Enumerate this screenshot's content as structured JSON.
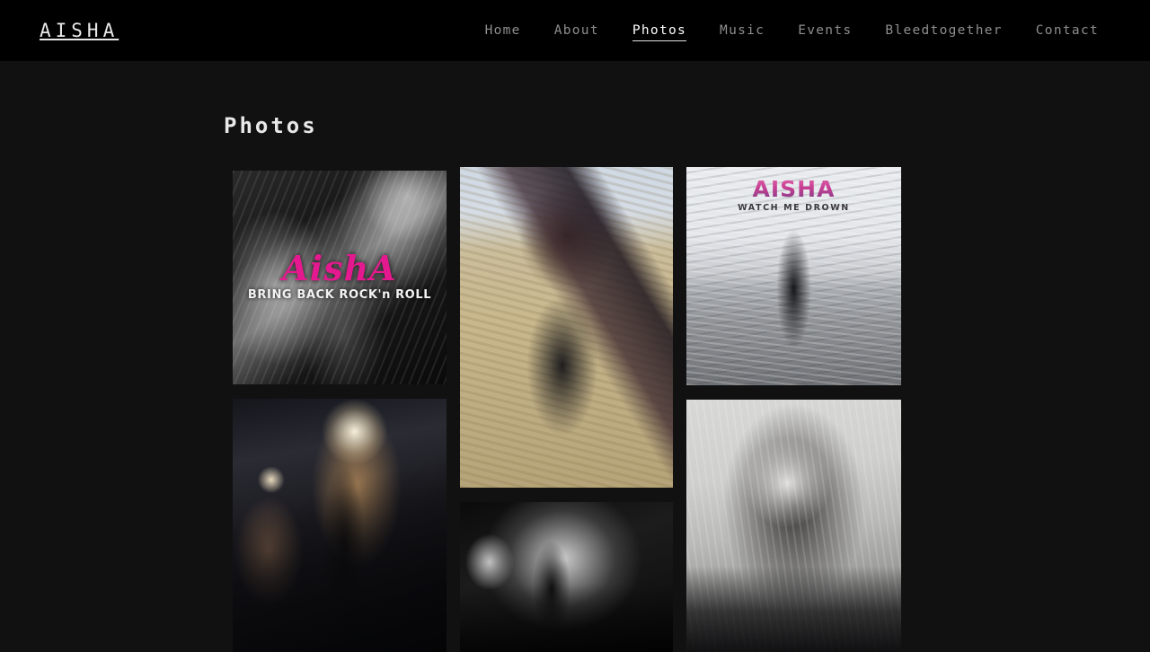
{
  "site": {
    "logo": "AISHA",
    "background_color": "#111111",
    "header_color": "#000000",
    "accent_color": "#e5198f"
  },
  "nav": {
    "items": [
      {
        "label": "Home",
        "active": false
      },
      {
        "label": "About",
        "active": false
      },
      {
        "label": "Photos",
        "active": true
      },
      {
        "label": "Music",
        "active": false
      },
      {
        "label": "Events",
        "active": false
      },
      {
        "label": "Bleedtogether",
        "active": false
      },
      {
        "label": "Contact",
        "active": false
      }
    ]
  },
  "page": {
    "title": "Photos"
  },
  "gallery": {
    "columns": [
      {
        "photos": [
          {
            "name": "live-aisha-bring-back-rock",
            "alt": "Black and white live performance photo with pink AishA logo overlay",
            "overlay_title": "AishA",
            "overlay_subtitle": "BRING BACK ROCK'n ROLL"
          },
          {
            "name": "live-concert-stage",
            "alt": "Singer at microphone on stage with warm stage lighting and guitarist behind"
          }
        ]
      },
      {
        "photos": [
          {
            "name": "portrait-with-guitar-field",
            "alt": "Woman holding electric guitar standing in a golden field, leather jacket and leopard print strap"
          },
          {
            "name": "live-black-white-microphone",
            "alt": "Black and white live shot of singer leaning into microphone"
          }
        ]
      },
      {
        "photos": [
          {
            "name": "album-cover-watch-me-drown",
            "alt": "Album cover: figure standing in a tall grass field, black and white",
            "overlay_title": "AISHA",
            "overlay_subtitle": "WATCH ME DROWN"
          },
          {
            "name": "portrait-headshot-black-white",
            "alt": "Black and white close-up portrait headshot with hoop earrings"
          }
        ]
      }
    ]
  }
}
